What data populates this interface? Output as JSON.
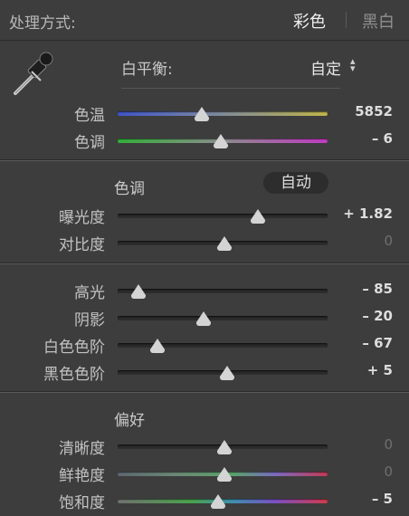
{
  "header": {
    "title": "处理方式:",
    "mode_color": "彩色",
    "mode_bw": "黑白"
  },
  "white_balance": {
    "label": "白平衡:",
    "value": "自定",
    "arrows_icon": "updown-arrows-icon"
  },
  "wb_sliders": [
    {
      "label": "色温",
      "value": "5852",
      "position": 0.4,
      "track": "temp"
    },
    {
      "label": "色调",
      "value": "– 6",
      "position": 0.49,
      "track": "tint"
    }
  ],
  "tone": {
    "title": "色调",
    "auto_label": "自动",
    "sliders": [
      {
        "label": "曝光度",
        "value": "+ 1.82",
        "position": 0.67,
        "track": "gray"
      },
      {
        "label": "对比度",
        "value": "0",
        "position": 0.51,
        "track": "gray"
      }
    ]
  },
  "tone2": {
    "sliders": [
      {
        "label": "高光",
        "value": "– 85",
        "position": 0.1,
        "track": "gray"
      },
      {
        "label": "阴影",
        "value": "– 20",
        "position": 0.41,
        "track": "gray"
      },
      {
        "label": "白色色阶",
        "value": "– 67",
        "position": 0.19,
        "track": "gray"
      },
      {
        "label": "黑色色阶",
        "value": "+ 5",
        "position": 0.52,
        "track": "gray"
      }
    ]
  },
  "presence": {
    "title": "偏好",
    "sliders": [
      {
        "label": "清晰度",
        "value": "0",
        "position": 0.51,
        "track": "gray"
      },
      {
        "label": "鲜艳度",
        "value": "0",
        "position": 0.51,
        "track": "vibrance"
      },
      {
        "label": "饱和度",
        "value": "– 5",
        "position": 0.48,
        "track": "saturation"
      }
    ]
  },
  "colors": {
    "background": "#3d3d3d",
    "thumb": "#d4d4d4",
    "active_value": "#dedede",
    "zero_value": "#6f6f6f"
  }
}
